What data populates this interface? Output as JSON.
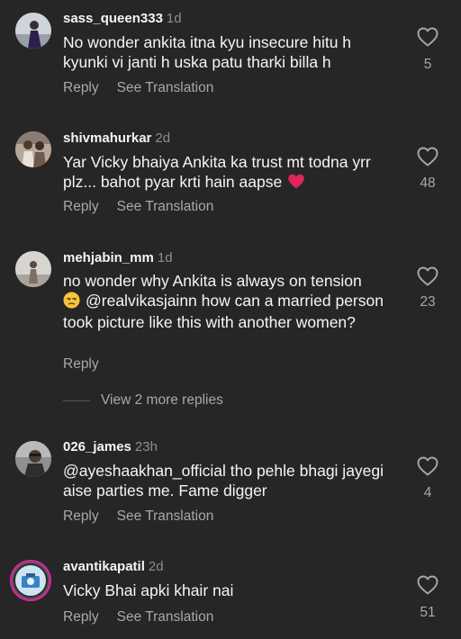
{
  "colors": {
    "background": "#262626",
    "text": "#f5f5f5",
    "muted": "#a8a8a8",
    "time": "#8e8e8e"
  },
  "comments": [
    {
      "username": "sass_queen333",
      "time": "1d",
      "text": "No wonder ankita itna kyu insecure hitu h kyunki vi janti h uska patu tharki billa h",
      "reply_label": "Reply",
      "translate_label": "See Translation",
      "like_count": "5"
    },
    {
      "username": "shivmahurkar",
      "time": "2d",
      "text": "Yar Vicky bhaiya Ankita ka trust mt todna yrr plz... bahot pyar krti hain aapse",
      "reply_label": "Reply",
      "translate_label": "See Translation",
      "like_count": "48"
    },
    {
      "username": "mehjabin_mm",
      "time": "1d",
      "text_line1": "no wonder why Ankita is always on tension",
      "text_rest": "@realvikasjainn how can a married person took picture like this with another women?",
      "reply_label": "Reply",
      "like_count": "23",
      "more_replies": "View 2 more replies"
    },
    {
      "username": "026_james",
      "time": "23h",
      "text": "@ayeshaakhan_official tho pehle bhagi jayegi aise parties me. Fame digger",
      "reply_label": "Reply",
      "translate_label": "See Translation",
      "like_count": "4"
    },
    {
      "username": "avantikapatil",
      "time": "2d",
      "text": "Vicky Bhai apki khair nai",
      "reply_label": "Reply",
      "translate_label": "See Translation",
      "like_count": "51"
    }
  ]
}
